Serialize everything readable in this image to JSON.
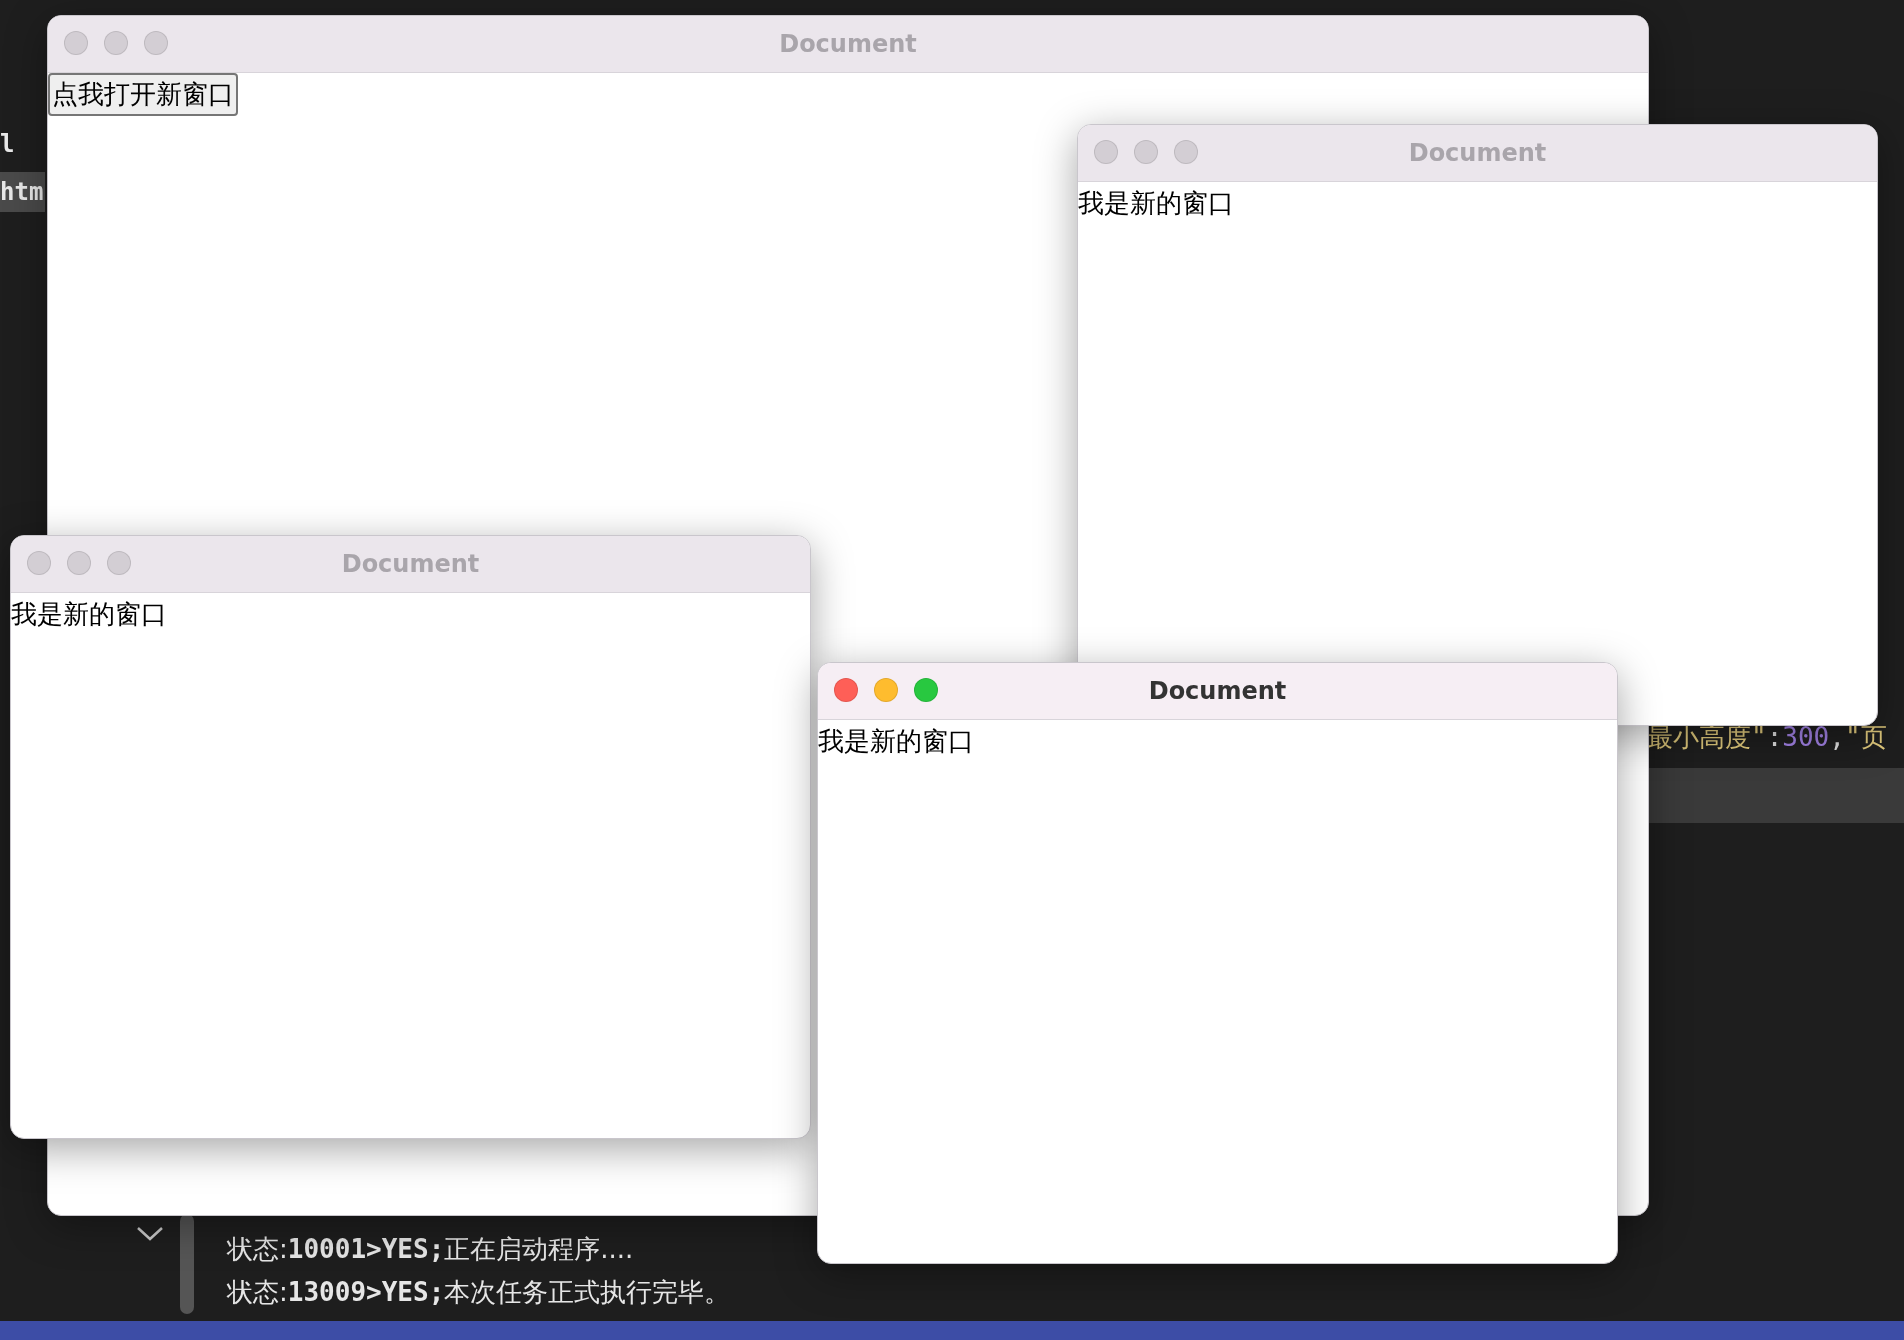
{
  "editor": {
    "left_fragments": [
      "l",
      "htm"
    ],
    "code_line": [
      {
        "kind": "string",
        "text": "最小高度\""
      },
      {
        "kind": "punct",
        "text": ":"
      },
      {
        "kind": "number",
        "text": "300"
      },
      {
        "kind": "punct",
        "text": ","
      },
      {
        "kind": "string",
        "text": "\"页"
      }
    ],
    "console": [
      {
        "label": "状态:",
        "code": "10001>YES;",
        "message": "正在启动程序...."
      },
      {
        "label": "状态:",
        "code": "13009>YES;",
        "message": "本次任务正式执行完毕。"
      }
    ]
  },
  "windows": [
    {
      "title": "Document",
      "active": false,
      "content": {
        "kind": "button",
        "text": "点我打开新窗口"
      }
    },
    {
      "title": "Document",
      "active": false,
      "content": {
        "kind": "text",
        "text": "我是新的窗口"
      }
    },
    {
      "title": "Document",
      "active": false,
      "content": {
        "kind": "text",
        "text": "我是新的窗口"
      }
    },
    {
      "title": "Document",
      "active": true,
      "content": {
        "kind": "text",
        "text": "我是新的窗口"
      }
    }
  ]
}
